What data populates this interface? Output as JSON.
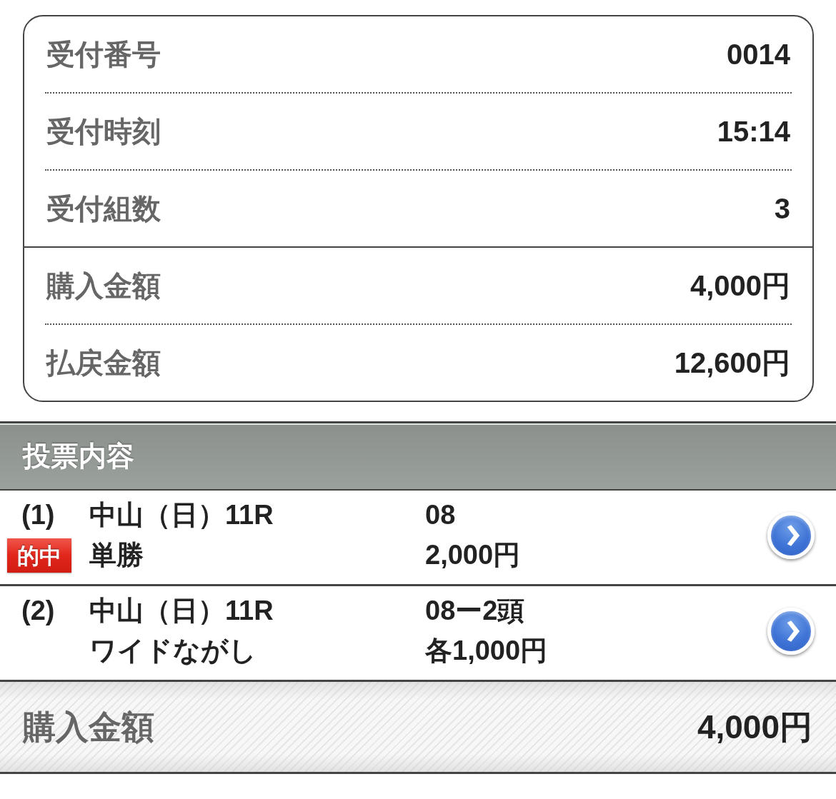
{
  "summary": {
    "sections": [
      {
        "rows": [
          {
            "label": "受付番号",
            "value": "0014"
          },
          {
            "label": "受付時刻",
            "value": "15:14"
          },
          {
            "label": "受付組数",
            "value": "3"
          }
        ]
      },
      {
        "rows": [
          {
            "label": "購入金額",
            "value": "4,000円"
          },
          {
            "label": "払戻金額",
            "value": "12,600円"
          }
        ]
      }
    ]
  },
  "bets_header": {
    "title": "投票内容"
  },
  "bets": [
    {
      "number": "(1)",
      "badge": "的中",
      "race": "中山（日）11R",
      "bet_type": "単勝",
      "selection": "08",
      "amount": "2,000円"
    },
    {
      "number": "(2)",
      "race": "中山（日）11R",
      "bet_type": "ワイドながし",
      "selection": "08ー2頭",
      "amount": "各1,000円"
    }
  ],
  "total": {
    "label": "購入金額",
    "value": "4,000円"
  }
}
